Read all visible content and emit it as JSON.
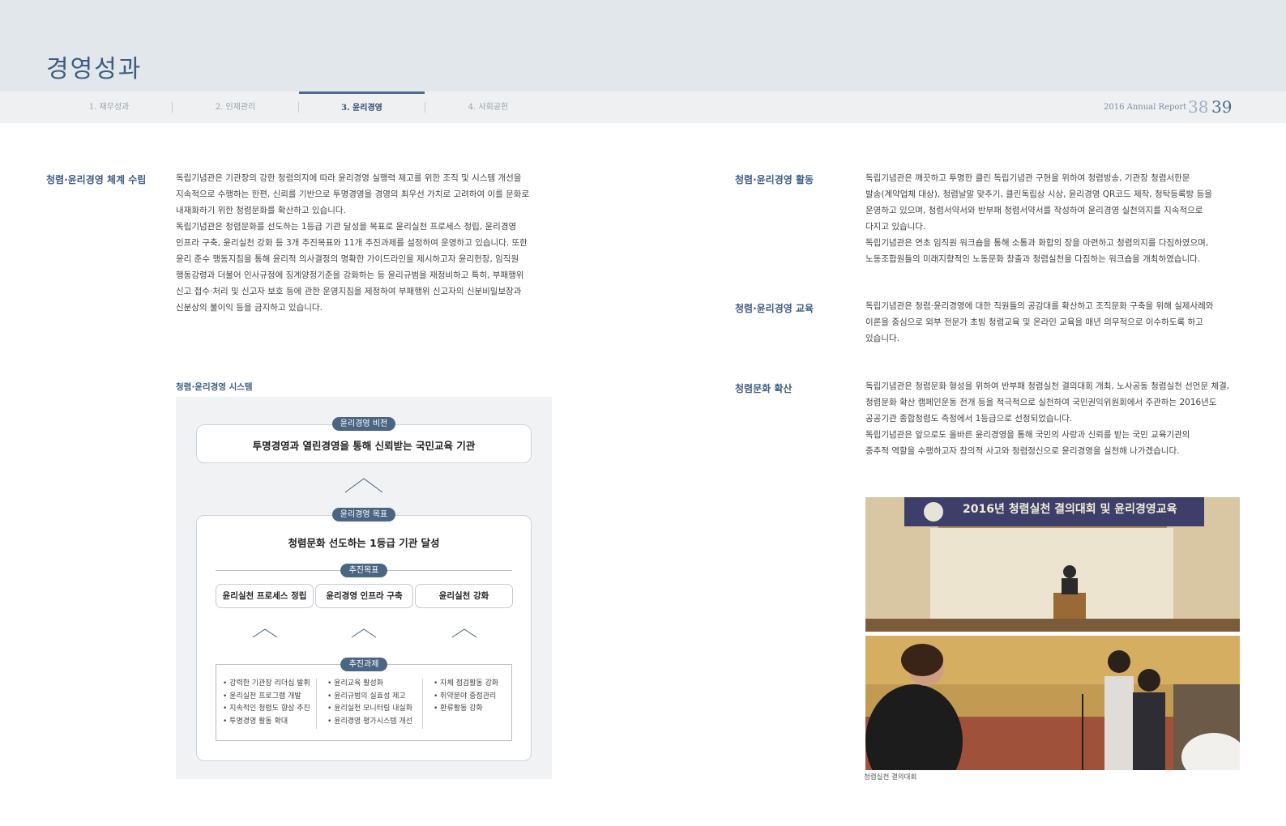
{
  "header": {
    "title": "경영성과",
    "tabs": [
      {
        "label": "1. 재무성과"
      },
      {
        "label": "2. 인재관리"
      },
      {
        "label": "3. 윤리경영"
      },
      {
        "label": "4. 사회공헌"
      }
    ],
    "annual_report": "2016 Annual Report",
    "page_left": "38",
    "page_right": "39"
  },
  "left": {
    "section1": {
      "heading": "청렴·윤리경영 체계 수립",
      "lines": [
        "독립기념관은 기관장의 강한 청렴의지에 따라 윤리경영 실행력 제고를 위한 조직 및 시스템 개선을",
        "지속적으로 수행하는 한편, 신뢰를 기반으로 투명경영을 경영의 최우선 가치로 고려하여 이를 문화로",
        "내재화하기 위한 청렴문화를 확산하고 있습니다.",
        "독립기념관은 청렴문화를 선도하는 1등급 기관 달성을 목표로 윤리실천 프로세스 정립, 윤리경영",
        "인프라 구축, 윤리실천 강화 등 3개 추진목표와 11개 추진과제를 설정하여 운영하고 있습니다. 또한",
        "윤리 준수 행동지침을 통해 윤리적 의사결정의 명확한 가이드라인을 제시하고자 윤리헌장, 임직원",
        "행동강령과 더불어 인사규정에 징계양정기준을 강화하는 등 윤리규범을 재정비하고 특히, 부패행위",
        "신고 접수·처리 및 신고자 보호 등에 관한 운영지침을 제정하여 부패행위 신고자의 신분비밀보장과",
        "신분상의 불이익 등을 금지하고 있습니다."
      ]
    },
    "diagram": {
      "title": "청렴·윤리경영 시스템",
      "vision_label": "윤리경영 비전",
      "vision_text": "투명경영과 열린경영을 통해 신뢰받는 국민교육 기관",
      "goal_label": "윤리경영 목표",
      "goal_text": "청렴문화 선도하는 1등급 기관 달성",
      "targets_label": "추진목표",
      "targets": [
        "윤리실천 프로세스 정립",
        "윤리경영 인프라 구축",
        "윤리실천 강화"
      ],
      "tasks_label": "추진과제",
      "tasks": [
        [
          "• 강력한 기관장 리더십 발휘",
          "• 윤리실천 프로그램 개발",
          "• 지속적인 청렴도 향상 추진",
          "• 투명경영 활동 확대"
        ],
        [
          "• 윤리교육 활성화",
          "• 윤리규범의 실효성 제고",
          "• 윤리실천 모니터링 내실화",
          "• 윤리경영 평가시스템 개선"
        ],
        [
          "• 자체 점검활동 강화",
          "• 취약분야 중점관리",
          "• 환류활동 강화"
        ]
      ]
    }
  },
  "right": {
    "section1": {
      "heading": "청렴·윤리경영 활동",
      "lines": [
        "독립기념관은 깨끗하고 투명한 클린 독립기념관 구현을 위하여 청렴방송, 기관장 청렴서한문",
        "발송(계약업체 대상), 청렴날말 맞추기, 클린독립상 시상, 윤리경영 QR코드 제작, 청탁등록방 등을",
        "운영하고 있으며, 청렴서약서와 반부패 청렴서약서를 작성하여 윤리경영 실천의지를 지속적으로",
        "다지고 있습니다.",
        "독립기념관은 연초 임직원 워크숍을 통해 소통과 화합의 장을 마련하고 청렴의지를 다짐하였으며,",
        "노동조합원들의 미래지향적인 노동문화 창출과 청렴실천을 다짐하는 워크숍을 개최하였습니다."
      ]
    },
    "section2": {
      "heading": "청렴·윤리경영 교육",
      "lines": [
        "독립기념관은 청렴·윤리경영에 대한 직원들의 공감대를 확산하고 조직문화 구축을 위해 실제사례와",
        "이론을 중심으로 외부 전문가 초빙 청렴교육 및 온라인 교육을 매년 의무적으로 이수하도록 하고",
        "있습니다."
      ]
    },
    "section3": {
      "heading": "청렴문화 확산",
      "lines": [
        "독립기념관은 청렴문화 형성을 위하여 반부패 청렴실천 결의대회 개최, 노사공동 청렴실천 선언문 체결,",
        "청렴문화 확산 캠페인운동 전개 등을 적극적으로 실천하여 국민권익위원회에서 주관하는 2016년도",
        "공공기관 종합청렴도 측정에서 1등급으로 선정되었습니다.",
        "독립기념관은 앞으로도 올바른 윤리경영을 통해 국민의 사랑과 신뢰를 받는 국민 교육기관의",
        "중추적 역할을 수행하고자 창의적 사고와 청렴정신으로 윤리경영을 실천해 나가겠습니다."
      ]
    },
    "photo": {
      "banner": "2016년 청렴실천 결의대회 및 윤리경영교육",
      "caption": "청렴실천 결의대회"
    }
  }
}
